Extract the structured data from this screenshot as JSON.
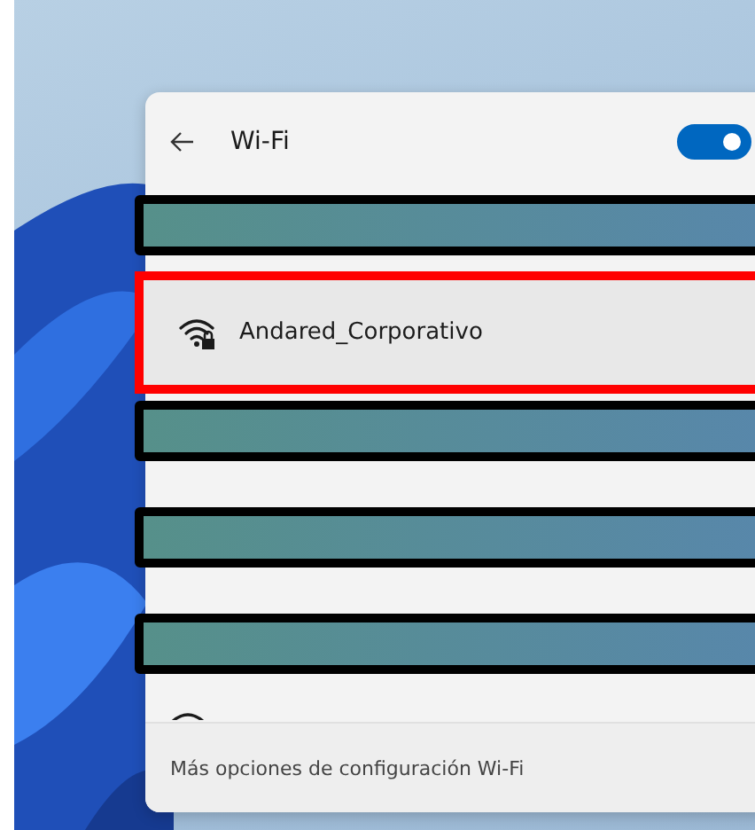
{
  "panel": {
    "title": "Wi-Fi",
    "wifi_on": true
  },
  "rows": [
    {
      "kind": "redacted"
    },
    {
      "kind": "network",
      "name": "Andared_Corporativo",
      "secured": true,
      "highlighted": true
    },
    {
      "kind": "redacted"
    },
    {
      "kind": "redacted"
    },
    {
      "kind": "redacted"
    },
    {
      "kind": "partial"
    }
  ],
  "footer": {
    "link": "Más opciones de configuración Wi-Fi"
  }
}
